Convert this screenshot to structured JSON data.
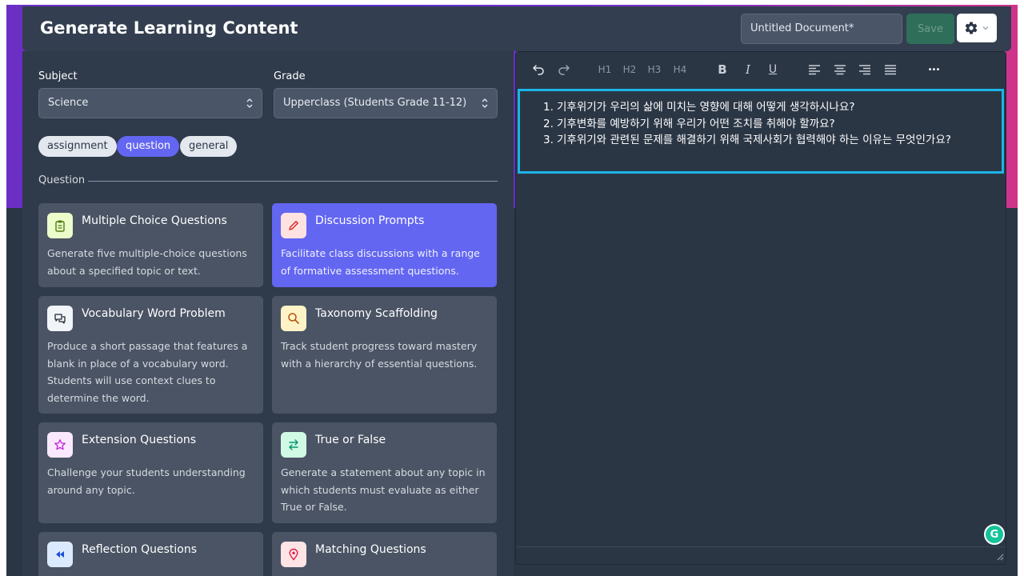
{
  "header": {
    "title": "Generate Learning Content",
    "doc_title": "Untitled Document*",
    "save_label": "Save",
    "settings_icon": "gear-icon"
  },
  "form": {
    "subject_label": "Subject",
    "subject_value": "Science",
    "grade_label": "Grade",
    "grade_value": "Upperclass (Students Grade 11-12)",
    "tags": [
      {
        "label": "assignment",
        "active": false
      },
      {
        "label": "question",
        "active": true
      },
      {
        "label": "general",
        "active": false
      }
    ],
    "section_label": "Question"
  },
  "cards": [
    {
      "title": "Multiple Choice Questions",
      "desc": "Generate five multiple-choice questions about a specified topic or text.",
      "icon": "clipboard-icon",
      "icon_color": "#4d7c0f",
      "icon_bg": "#ecfccb"
    },
    {
      "title": "Discussion Prompts",
      "desc": "Facilitate class discussions with a range of formative assessment questions.",
      "icon": "pencil-icon",
      "icon_color": "#dc2626",
      "icon_bg": "#fee2e2",
      "selected": true
    },
    {
      "title": "Vocabulary Word Problem",
      "desc": "Produce a short passage that features a blank in place of a vocabulary word. Students will use context clues to determine the word.",
      "icon": "chat-icon",
      "icon_color": "#1f2937",
      "icon_bg": "#f1f5f9"
    },
    {
      "title": "Taxonomy Scaffolding",
      "desc": "Track student progress toward mastery with a hierarchy of essential questions.",
      "icon": "magnifier-icon",
      "icon_color": "#b45309",
      "icon_bg": "#fef3c7"
    },
    {
      "title": "Extension Questions",
      "desc": "Challenge your students understanding around any topic.",
      "icon": "star-icon",
      "icon_color": "#c026d3",
      "icon_bg": "#fae8ff"
    },
    {
      "title": "True or False",
      "desc": "Generate a statement about any topic in which students must evaluate as either True or False.",
      "icon": "swap-arrows-icon",
      "icon_color": "#059669",
      "icon_bg": "#d1fae5"
    },
    {
      "title": "Reflection Questions",
      "desc": "",
      "icon": "rewind-icon",
      "icon_color": "#1d4ed8",
      "icon_bg": "#dbeafe"
    },
    {
      "title": "Matching Questions",
      "desc": "",
      "icon": "location-pin-icon",
      "icon_color": "#e11d48",
      "icon_bg": "#ffe4e6"
    }
  ],
  "toolbar": {
    "h1": "H1",
    "h2": "H2",
    "h3": "H3",
    "h4": "H4",
    "bold": "B",
    "italic": "I",
    "underline": "U",
    "more": "•••"
  },
  "editor": {
    "items": [
      {
        "num": "1.",
        "text": "기후위기가 우리의 삶에 미치는 영향에 대해 어떻게 생각하시나요?"
      },
      {
        "num": "2.",
        "text": "기후변화를 예방하기 위해 우리가 어떤 조치를 취해야 할까요?"
      },
      {
        "num": "3.",
        "text": "기후위기와 관련된 문제를 해결하기 위해 국제사회가 협력해야 하는 이유는 무엇인가요?"
      }
    ],
    "grammarly_letter": "G"
  },
  "colors": {
    "accent": "#6366f1",
    "focus_border": "#1ab5e6",
    "save_bg": "#2f6f5a"
  }
}
